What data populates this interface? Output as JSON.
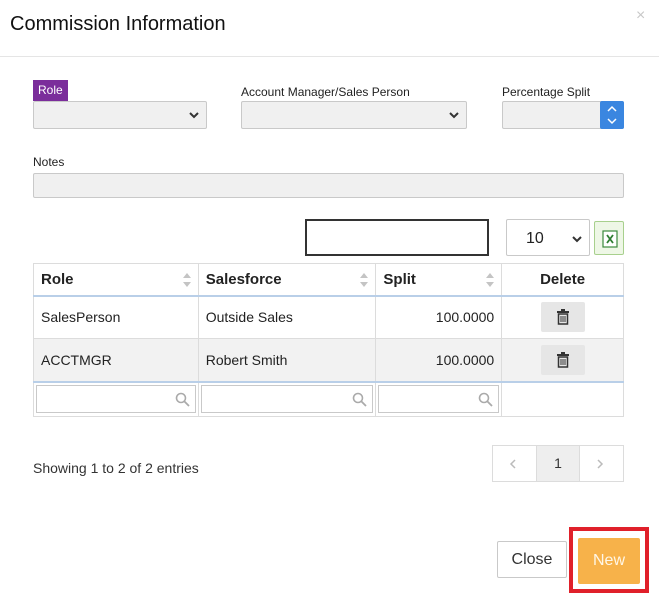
{
  "modal": {
    "title": "Commission Information",
    "close_glyph": "×"
  },
  "form": {
    "role_label": "Role",
    "role_value": "",
    "account_manager_label": "Account Manager/Sales Person",
    "account_manager_value": "",
    "percentage_label": "Percentage Split",
    "percentage_value": "",
    "notes_label": "Notes",
    "notes_value": ""
  },
  "toolbar": {
    "search_value": "",
    "page_length": "10",
    "excel_icon": "excel-export-icon"
  },
  "table": {
    "headers": [
      "Role",
      "Salesforce",
      "Split",
      "Delete"
    ],
    "rows": [
      {
        "role": "SalesPerson",
        "salesforce": "Outside Sales",
        "split": "100.0000"
      },
      {
        "role": "ACCTMGR",
        "salesforce": "Robert Smith",
        "split": "100.0000"
      }
    ]
  },
  "footer": {
    "info": "Showing 1 to 2 of 2 entries",
    "prev_glyph": "‹",
    "current_page": "1",
    "next_glyph": "›"
  },
  "actions": {
    "close_label": "Close",
    "new_label": "New"
  },
  "colors": {
    "role_badge": "#7b2d9b",
    "spinner": "#3a86e0",
    "new_button": "#f7b24a",
    "highlight": "#e0202a"
  }
}
